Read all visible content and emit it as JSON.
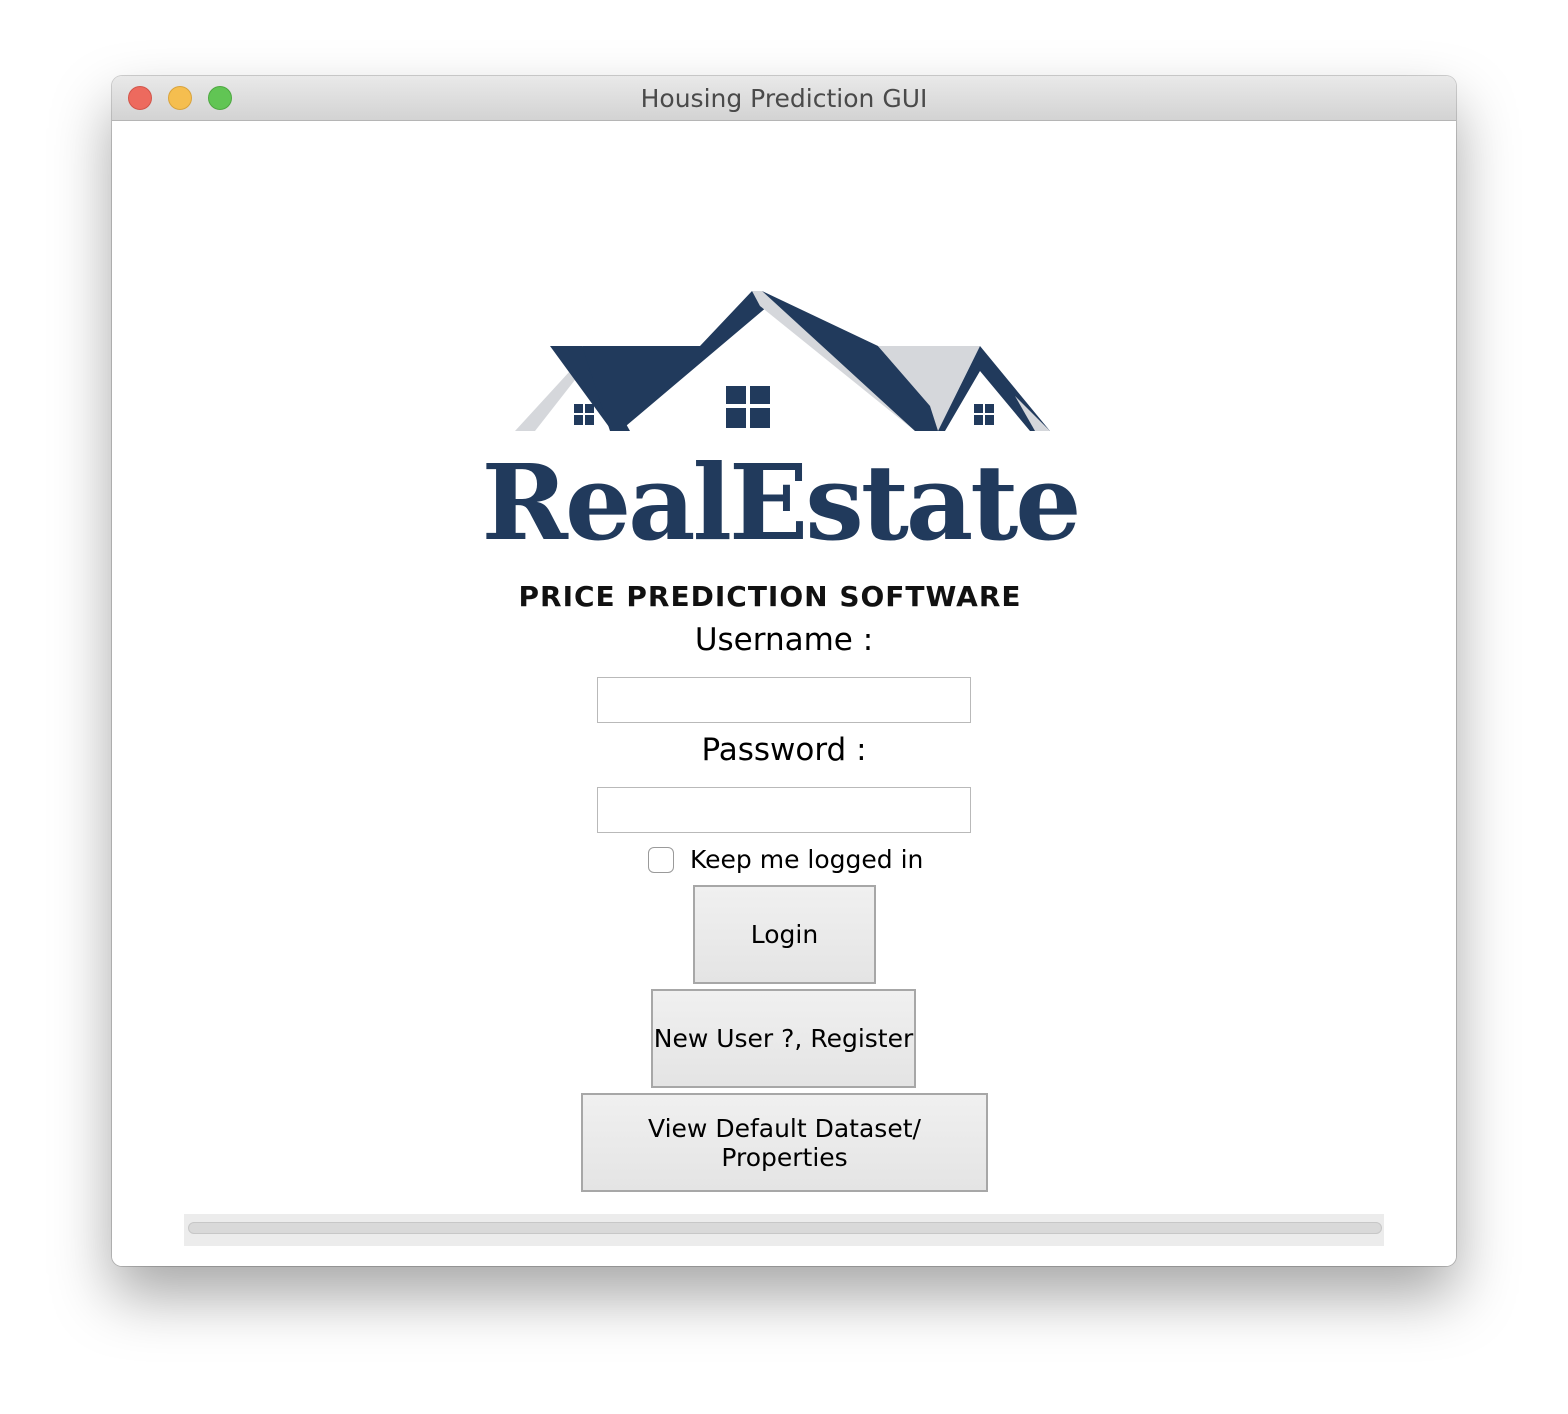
{
  "window": {
    "title": "Housing Prediction GUI"
  },
  "logo": {
    "brand": "RealEstate",
    "tagline": "PRICE PREDICTION SOFTWARE",
    "colors": {
      "navy": "#213a5c",
      "gray": "#d5d7db"
    }
  },
  "form": {
    "username_label": "Username :",
    "username_value": "",
    "password_label": "Password :",
    "password_value": "",
    "keep_logged_in_label": "Keep me logged in",
    "keep_logged_in_checked": false
  },
  "buttons": {
    "login": "Login",
    "register": "New User ?, Register",
    "view_dataset": "View Default Dataset/ Properties"
  }
}
